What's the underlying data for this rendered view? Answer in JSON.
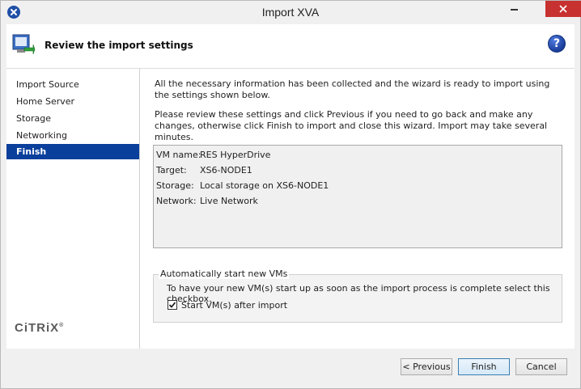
{
  "window": {
    "title": "Import XVA"
  },
  "header": {
    "title": "Review the import settings",
    "help_glyph": "?"
  },
  "nav": {
    "items": [
      {
        "label": "Import Source",
        "active": false
      },
      {
        "label": "Home Server",
        "active": false
      },
      {
        "label": "Storage",
        "active": false
      },
      {
        "label": "Networking",
        "active": false
      },
      {
        "label": "Finish",
        "active": true
      }
    ],
    "logo_text": "CiTRiX"
  },
  "main": {
    "intro": "All the necessary information has been collected and the wizard is ready to import using the settings shown below.",
    "instructions": "Please review these settings and click Previous if you need to go back and make any changes, otherwise click Finish to import and close this wizard.  Import may take several minutes.",
    "summary": [
      {
        "key": "VM name:",
        "value": "RES HyperDrive"
      },
      {
        "key": "Target:",
        "value": "XS6-NODE1"
      },
      {
        "key": "Storage:",
        "value": "Local storage on XS6-NODE1"
      },
      {
        "key": "Network:",
        "value": "Live Network"
      }
    ],
    "autostart": {
      "legend": "Automatically start new VMs",
      "description": "To have your new VM(s) start up as soon as the import process is complete select this checkbox.",
      "checkbox_label": "Start VM(s) after import",
      "checked": true
    }
  },
  "buttons": {
    "previous": "< Previous",
    "finish": "Finish",
    "cancel": "Cancel"
  },
  "colors": {
    "nav_active": "#0a3f9c",
    "close_button": "#c7312f"
  }
}
